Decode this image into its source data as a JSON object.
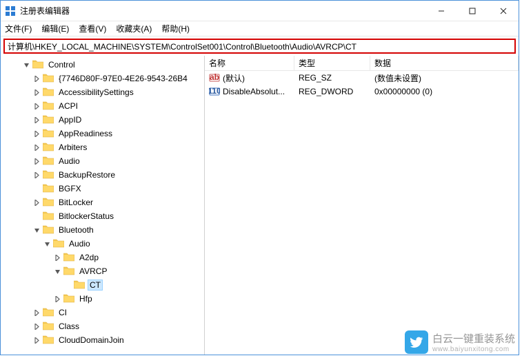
{
  "window": {
    "title": "注册表编辑器"
  },
  "menu": {
    "file": "文件(F)",
    "edit": "编辑(E)",
    "view": "查看(V)",
    "favorites": "收藏夹(A)",
    "help": "帮助(H)"
  },
  "address": "计算机\\HKEY_LOCAL_MACHINE\\SYSTEM\\ControlSet001\\Control\\Bluetooth\\Audio\\AVRCP\\CT",
  "tree": {
    "nodes": [
      {
        "indent": 30,
        "expander": "open",
        "label": "Control"
      },
      {
        "indent": 45,
        "expander": "closed",
        "label": "{7746D80F-97E0-4E26-9543-26B4"
      },
      {
        "indent": 45,
        "expander": "closed",
        "label": "AccessibilitySettings"
      },
      {
        "indent": 45,
        "expander": "closed",
        "label": "ACPI"
      },
      {
        "indent": 45,
        "expander": "closed",
        "label": "AppID"
      },
      {
        "indent": 45,
        "expander": "closed",
        "label": "AppReadiness"
      },
      {
        "indent": 45,
        "expander": "closed",
        "label": "Arbiters"
      },
      {
        "indent": 45,
        "expander": "closed",
        "label": "Audio"
      },
      {
        "indent": 45,
        "expander": "closed",
        "label": "BackupRestore"
      },
      {
        "indent": 45,
        "expander": "none",
        "label": "BGFX"
      },
      {
        "indent": 45,
        "expander": "closed",
        "label": "BitLocker"
      },
      {
        "indent": 45,
        "expander": "none",
        "label": "BitlockerStatus"
      },
      {
        "indent": 45,
        "expander": "open",
        "label": "Bluetooth"
      },
      {
        "indent": 60,
        "expander": "open",
        "label": "Audio"
      },
      {
        "indent": 75,
        "expander": "closed",
        "label": "A2dp"
      },
      {
        "indent": 75,
        "expander": "open",
        "label": "AVRCP"
      },
      {
        "indent": 90,
        "expander": "none",
        "label": "CT",
        "selected": true
      },
      {
        "indent": 75,
        "expander": "closed",
        "label": "Hfp"
      },
      {
        "indent": 45,
        "expander": "closed",
        "label": "CI"
      },
      {
        "indent": 45,
        "expander": "closed",
        "label": "Class"
      },
      {
        "indent": 45,
        "expander": "closed",
        "label": "CloudDomainJoin"
      }
    ]
  },
  "columns": {
    "name": "名称",
    "type": "类型",
    "data": "数据"
  },
  "values": [
    {
      "icon": "string",
      "name": "(默认)",
      "type": "REG_SZ",
      "data": "(数值未设置)"
    },
    {
      "icon": "binary",
      "name": "DisableAbsolut...",
      "type": "REG_DWORD",
      "data": "0x00000000 (0)"
    }
  ],
  "watermark": {
    "line1": "白云一键重装系统",
    "line2": "www.baiyunxitong.com"
  }
}
